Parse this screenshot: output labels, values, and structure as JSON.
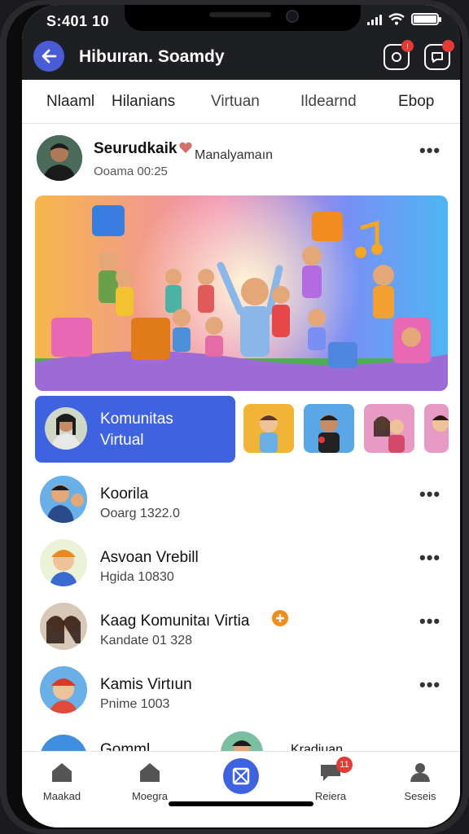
{
  "status_bar": {
    "time": "S:401 10"
  },
  "header": {
    "title": "Hibuıran. Soamdy"
  },
  "tabs": [
    {
      "label": "Nlaaml"
    },
    {
      "label": "Hilanians"
    },
    {
      "label": "Virtuan"
    },
    {
      "label": "Ildearnd"
    },
    {
      "label": "Ebop"
    }
  ],
  "post": {
    "author": "Seurudkaik",
    "subtitle": "Manalyamaın",
    "time": "Ooama 00:25"
  },
  "community_card": {
    "title": "Komunitas",
    "subtitle": "Virtual"
  },
  "list": [
    {
      "name": "Koorila",
      "sub": "Ooarg 1322.0"
    },
    {
      "name": "Asvoan Vrebill",
      "sub": "Hgida 10830"
    },
    {
      "name": "Kaag Komunitaı Virtia",
      "sub": "Kandate 01 328"
    },
    {
      "name": "Kamis Virtıun",
      "sub": "Pnime 1003"
    },
    {
      "name": "Gomml",
      "sub": ""
    }
  ],
  "partial_label_right": "Kradiuan",
  "bottom_nav": [
    {
      "label": "Maakad"
    },
    {
      "label": "Moegra"
    },
    {
      "label": "Reiera",
      "badge": "11"
    },
    {
      "label": "Seseis"
    }
  ],
  "colors": {
    "accent": "#3f63e0",
    "header_bg": "#1e1f22",
    "badge": "#e53935"
  }
}
